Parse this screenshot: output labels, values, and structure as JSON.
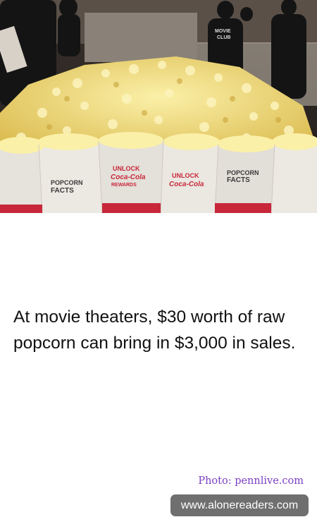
{
  "photo": {
    "bag_text_1": "UNLOCK",
    "bag_text_2": "Coca-Cola",
    "bag_text_3": "REWARDS",
    "bag_facts_1": "POPCORN",
    "bag_facts_2": "FACTS",
    "shirt_text_1": "MOVIE",
    "shirt_text_2": "CLUB"
  },
  "fact_text": "At movie theaters, $30 worth of raw popcorn can bring in $3,000 in sales.",
  "photo_credit": "Photo: pennlive.com",
  "watermark": "www.alonereaders.com",
  "colors": {
    "popcorn": "#f1d974",
    "bag": "#e6e2dc",
    "bag_red": "#c8273a",
    "credit": "#7b3fc4",
    "watermark_bg": "#6f6f6f"
  }
}
